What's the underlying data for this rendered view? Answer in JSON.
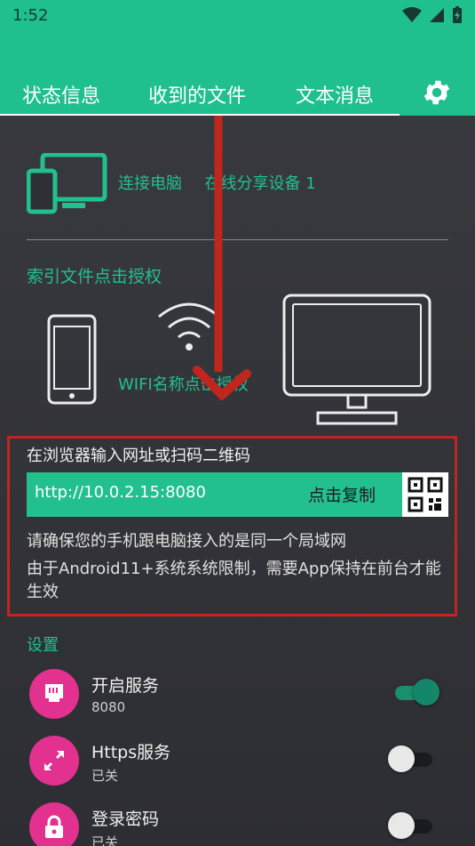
{
  "status_bar": {
    "time": "1:52"
  },
  "tabs": [
    {
      "label": "状态信息",
      "active": true
    },
    {
      "label": "收到的文件",
      "active": false
    },
    {
      "label": "文本消息",
      "active": false
    }
  ],
  "connection": {
    "label": "连接电脑",
    "devices_label": "在线分享设备 1"
  },
  "auth": {
    "label": "索引文件点击授权",
    "wifi_name": "WIFI名称点击授权"
  },
  "access": {
    "prompt": "在浏览器输入网址或扫码二维码",
    "url": "http://10.0.2.15:8080",
    "copy_label": "点击复制",
    "same_lan_note": "请确保您的手机跟电脑接入的是同一个局域网",
    "android_note": "由于Android11+系统系统限制，需要App保持在前台才能生效"
  },
  "settings": {
    "title": "设置",
    "items": [
      {
        "title": "开启服务",
        "subtitle": "8080",
        "enabled": true,
        "icon": "ethernet-icon"
      },
      {
        "title": "Https服务",
        "subtitle": "已关",
        "enabled": false,
        "icon": "expand-icon"
      },
      {
        "title": "登录密码",
        "subtitle": "已关",
        "enabled": false,
        "icon": "lock-icon"
      }
    ]
  },
  "colors": {
    "accent": "#22c08d",
    "annotation": "#c0251e",
    "setting_icon_bg": "#e2318f"
  }
}
